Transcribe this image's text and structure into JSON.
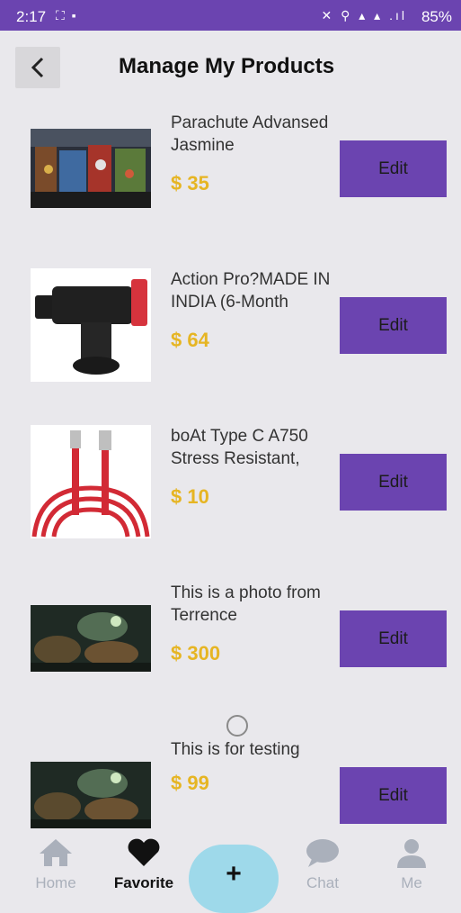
{
  "status_bar": {
    "time": "2:17",
    "left_icons": "⛶ ▪",
    "right_icons": "✕ ⚲ ▴ ▴ .ıl",
    "battery": "85%"
  },
  "header": {
    "back_icon": "chevron-left-icon",
    "title": "Manage My Products"
  },
  "products": [
    {
      "name": "Parachute Advansed Jasmine",
      "price": "$ 35",
      "edit_label": "Edit",
      "image": "shop-photo"
    },
    {
      "name": "Action Pro?MADE IN INDIA (6-Month",
      "price": "$ 64",
      "edit_label": "Edit",
      "image": "phone-mount"
    },
    {
      "name": "boAt Type C A750 Stress Resistant,",
      "price": "$ 10",
      "edit_label": "Edit",
      "image": "usb-cable"
    },
    {
      "name": "This is a photo from Terrence",
      "price": "$ 300",
      "edit_label": "Edit",
      "image": "fantasy-art"
    },
    {
      "name": "This is for testing",
      "price": "$ 99",
      "edit_label": "Edit",
      "image": "fantasy-art"
    }
  ],
  "bottom_nav": {
    "items": [
      {
        "label": "Home",
        "icon": "home-icon"
      },
      {
        "label": "Favorite",
        "icon": "heart-icon"
      },
      {
        "label": "+",
        "icon": "plus-icon"
      },
      {
        "label": "Chat",
        "icon": "chat-icon"
      },
      {
        "label": "Me",
        "icon": "user-icon"
      }
    ]
  },
  "colors": {
    "accent": "#6b44b0",
    "price": "#e6b523",
    "fab": "#9ed9ea",
    "background": "#e9e8ec"
  }
}
